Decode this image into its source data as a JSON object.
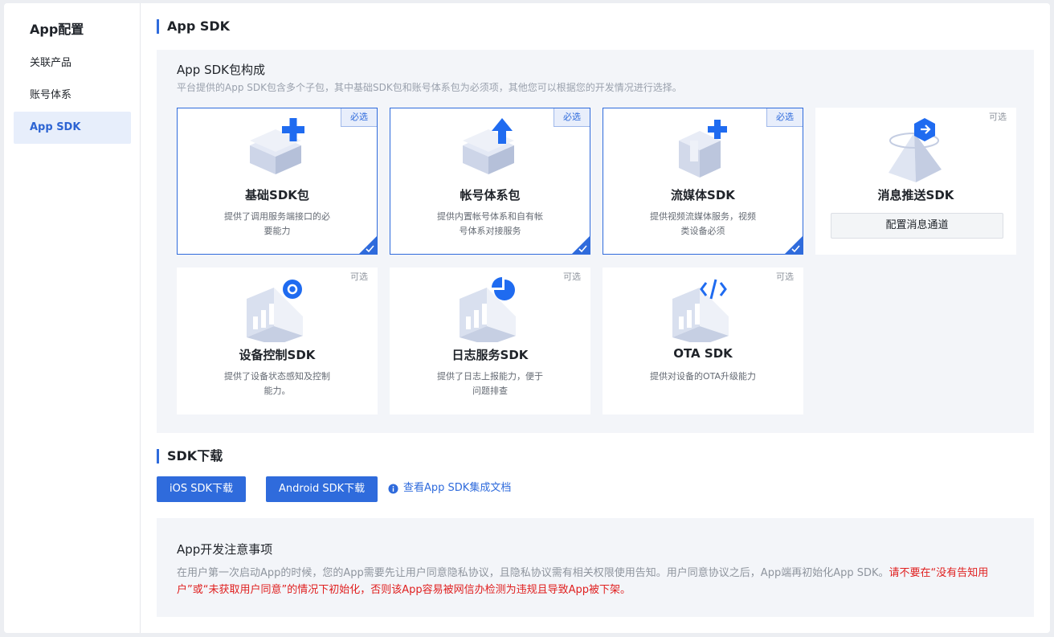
{
  "sidebar": {
    "title": "App配置",
    "items": [
      {
        "label": "关联产品"
      },
      {
        "label": "账号体系"
      },
      {
        "label": "App SDK"
      }
    ]
  },
  "section_sdk": {
    "title": "App SDK",
    "composition_title": "App SDK包构成",
    "composition_desc": "平台提供的App SDK包含多个子包，其中基础SDK包和账号体系包为必须项，其他您可以根据您的开发情况进行选择。",
    "cards": [
      {
        "name": "基础SDK包",
        "tag": "必选",
        "desc": "提供了调用服务端接口的必要能力",
        "icon": "cube-plus-icon",
        "selected": true
      },
      {
        "name": "帐号体系包",
        "tag": "必选",
        "desc": "提供内置帐号体系和自有帐号体系对接服务",
        "icon": "cube-arrow-up-icon",
        "selected": true
      },
      {
        "name": "流媒体SDK",
        "tag": "必选",
        "desc": "提供视频流媒体服务，视频类设备必须",
        "icon": "cube-plus-icon",
        "selected": true
      },
      {
        "name": "消息推送SDK",
        "tag": "可选",
        "button": "配置消息通道",
        "icon": "pyramid-arrow-icon",
        "selected": false
      },
      {
        "name": "设备控制SDK",
        "tag": "可选",
        "desc": "提供了设备状态感知及控制能力。",
        "icon": "gear-chart-icon",
        "selected": false
      },
      {
        "name": "日志服务SDK",
        "tag": "可选",
        "desc": "提供了日志上报能力，便于问题排查",
        "icon": "pie-chart-icon",
        "selected": false
      },
      {
        "name": "OTA SDK",
        "tag": "可选",
        "desc": "提供对设备的OTA升级能力",
        "icon": "code-icon",
        "selected": false
      }
    ]
  },
  "section_download": {
    "title": "SDK下载",
    "ios_button": "iOS SDK下载",
    "android_button": "Android SDK下载",
    "doc_link": "查看App SDK集成文档"
  },
  "notice": {
    "title": "App开发注意事项",
    "text": "在用户第一次启动App的时候，您的App需要先让用户同意隐私协议，且隐私协议需有相关权限使用告知。用户同意协议之后，App端再初始化App SDK。",
    "warning": "请不要在“没有告知用户”或“未获取用户同意”的情况下初始化，否则该App容易被网信办检测为违规且导致App被下架。"
  },
  "colors": {
    "accent": "#2f6bdc",
    "warning": "#e02020",
    "panel_bg": "#f3f5f9"
  }
}
